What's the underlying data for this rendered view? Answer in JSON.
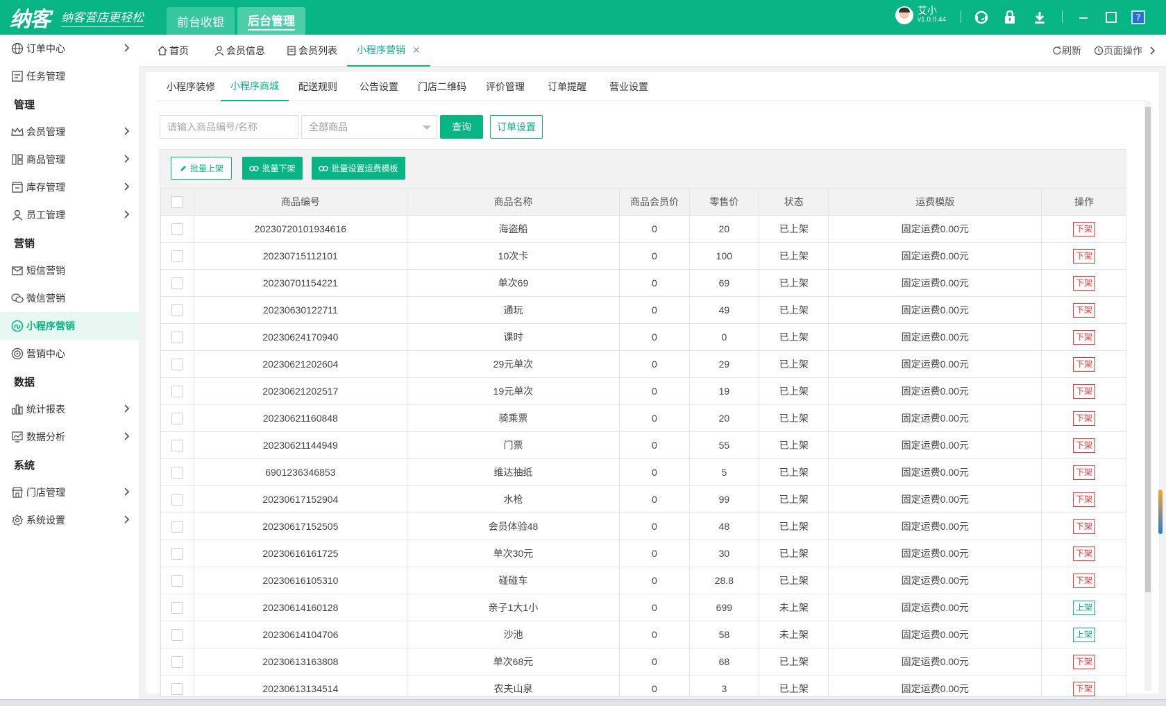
{
  "header": {
    "logo_text": "纳客",
    "slogan": "纳客营店更轻松",
    "tabs": [
      "前台收银",
      "后台管理"
    ],
    "user_name": "艾小",
    "version": "v1.0.0.44"
  },
  "sidebar": {
    "items": [
      {
        "label": "订单中心",
        "icon": "globe-icon",
        "chevron": true
      },
      {
        "label": "任务管理",
        "icon": "task-icon",
        "chevron": false
      },
      {
        "group": "管理"
      },
      {
        "label": "会员管理",
        "icon": "crown-icon",
        "chevron": true
      },
      {
        "label": "商品管理",
        "icon": "grid-icon",
        "chevron": true
      },
      {
        "label": "库存管理",
        "icon": "box-icon",
        "chevron": true
      },
      {
        "label": "员工管理",
        "icon": "person-icon",
        "chevron": true
      },
      {
        "group": "营销"
      },
      {
        "label": "短信营销",
        "icon": "mail-icon",
        "chevron": false
      },
      {
        "label": "微信营销",
        "icon": "wechat-icon",
        "chevron": false
      },
      {
        "label": "小程序营销",
        "icon": "miniprogram-icon",
        "chevron": false,
        "active": true
      },
      {
        "label": "营销中心",
        "icon": "target-icon",
        "chevron": false
      },
      {
        "group": "数据"
      },
      {
        "label": "统计报表",
        "icon": "bar-chart-icon",
        "chevron": true
      },
      {
        "label": "数据分析",
        "icon": "trend-icon",
        "chevron": true
      },
      {
        "group": "系统"
      },
      {
        "label": "门店管理",
        "icon": "store-icon",
        "chevron": true
      },
      {
        "label": "系统设置",
        "icon": "gear-icon",
        "chevron": true
      }
    ]
  },
  "page_tabs": {
    "items": [
      "首页",
      "会员信息",
      "会员列表",
      "小程序营销"
    ],
    "refresh": "刷新",
    "page_ops": "页面操作"
  },
  "subtabs": [
    "小程序装修",
    "小程序商城",
    "配送规则",
    "公告设置",
    "门店二维码",
    "评价管理",
    "订单提醒",
    "营业设置"
  ],
  "filters": {
    "search_placeholder": "请输入商品编号/名称",
    "category_value": "全部商品",
    "query_label": "查询",
    "order_settings_label": "订单设置"
  },
  "toolbar": {
    "batch_on": "批量上架",
    "batch_off": "批量下架",
    "batch_shipping": "批量设置运费模板"
  },
  "table": {
    "columns": [
      "商品编号",
      "商品名称",
      "商品会员价",
      "零售价",
      "状态",
      "运费模版",
      "操作"
    ],
    "rows": [
      {
        "code": "20230720101934616",
        "name": "海盗船",
        "member_price": "0",
        "price": "20",
        "status": "已上架",
        "shipping": "固定运费0.00元",
        "action": "下架"
      },
      {
        "code": "20230715112101",
        "name": "10次卡",
        "member_price": "0",
        "price": "100",
        "status": "已上架",
        "shipping": "固定运费0.00元",
        "action": "下架"
      },
      {
        "code": "20230701154221",
        "name": "单次69",
        "member_price": "0",
        "price": "69",
        "status": "已上架",
        "shipping": "固定运费0.00元",
        "action": "下架"
      },
      {
        "code": "20230630122711",
        "name": "通玩",
        "member_price": "0",
        "price": "49",
        "status": "已上架",
        "shipping": "固定运费0.00元",
        "action": "下架"
      },
      {
        "code": "20230624170940",
        "name": "课时",
        "member_price": "0",
        "price": "0",
        "status": "已上架",
        "shipping": "固定运费0.00元",
        "action": "下架"
      },
      {
        "code": "20230621202604",
        "name": "29元单次",
        "member_price": "0",
        "price": "29",
        "status": "已上架",
        "shipping": "固定运费0.00元",
        "action": "下架"
      },
      {
        "code": "20230621202517",
        "name": "19元单次",
        "member_price": "0",
        "price": "19",
        "status": "已上架",
        "shipping": "固定运费0.00元",
        "action": "下架"
      },
      {
        "code": "20230621160848",
        "name": "骑乘票",
        "member_price": "0",
        "price": "20",
        "status": "已上架",
        "shipping": "固定运费0.00元",
        "action": "下架"
      },
      {
        "code": "20230621144949",
        "name": "门票",
        "member_price": "0",
        "price": "55",
        "status": "已上架",
        "shipping": "固定运费0.00元",
        "action": "下架"
      },
      {
        "code": "6901236346853",
        "name": "维达抽纸",
        "member_price": "0",
        "price": "5",
        "status": "已上架",
        "shipping": "固定运费0.00元",
        "action": "下架"
      },
      {
        "code": "20230617152904",
        "name": "水枪",
        "member_price": "0",
        "price": "99",
        "status": "已上架",
        "shipping": "固定运费0.00元",
        "action": "下架"
      },
      {
        "code": "20230617152505",
        "name": "会员体验48",
        "member_price": "0",
        "price": "48",
        "status": "已上架",
        "shipping": "固定运费0.00元",
        "action": "下架"
      },
      {
        "code": "20230616161725",
        "name": "单次30元",
        "member_price": "0",
        "price": "30",
        "status": "已上架",
        "shipping": "固定运费0.00元",
        "action": "下架"
      },
      {
        "code": "20230616105310",
        "name": "碰碰车",
        "member_price": "0",
        "price": "28.8",
        "status": "已上架",
        "shipping": "固定运费0.00元",
        "action": "下架"
      },
      {
        "code": "20230614160128",
        "name": "亲子1大1小",
        "member_price": "0",
        "price": "699",
        "status": "未上架",
        "shipping": "固定运费0.00元",
        "action": "上架"
      },
      {
        "code": "20230614104706",
        "name": "沙池",
        "member_price": "0",
        "price": "58",
        "status": "未上架",
        "shipping": "固定运费0.00元",
        "action": "上架"
      },
      {
        "code": "20230613163808",
        "name": "单次68元",
        "member_price": "0",
        "price": "68",
        "status": "已上架",
        "shipping": "固定运费0.00元",
        "action": "下架"
      },
      {
        "code": "20230613134514",
        "name": "农夫山泉",
        "member_price": "0",
        "price": "3",
        "status": "已上架",
        "shipping": "固定运费0.00元",
        "action": "下架"
      }
    ]
  },
  "colors": {
    "brand": "#07b584",
    "danger": "#e33333"
  }
}
